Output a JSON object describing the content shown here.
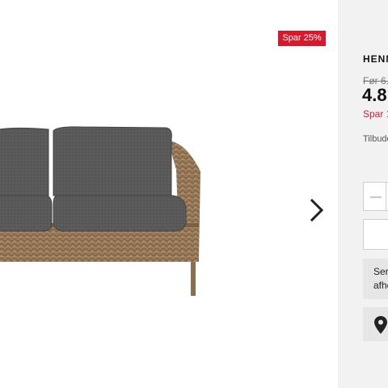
{
  "gallery": {
    "badge": "Spar 25%"
  },
  "product": {
    "title": "HENNI",
    "old_price": "Før 6.",
    "price": "4.8",
    "save_text": "Spar 1",
    "offer_text": "Tilbude"
  },
  "actions": {
    "info_line1": "Ser",
    "info_line2": "afhe"
  },
  "icons": {
    "next": "chevron-right-icon",
    "minus": "minus-icon",
    "store": "map-pin-icon"
  },
  "colors": {
    "accent": "#d7192d",
    "panel": "#f2f2f2",
    "cushion": "#5a5a5a",
    "wicker": "#9a7c5a"
  }
}
